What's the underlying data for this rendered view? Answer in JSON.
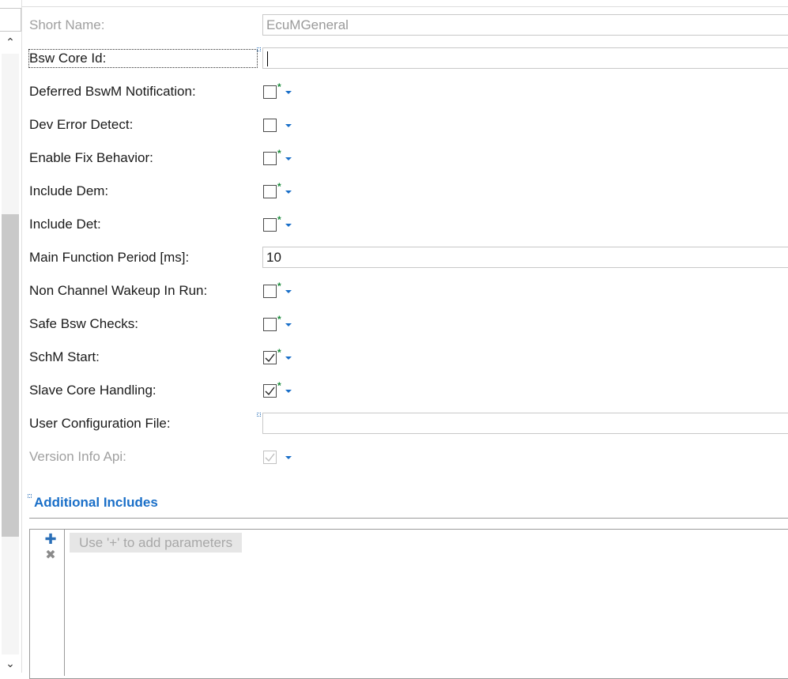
{
  "form": {
    "short_name": {
      "label": "Short Name:",
      "value": "EcuMGeneral"
    },
    "bsw_core_id": {
      "label": "Bsw Core Id:",
      "value": ""
    },
    "deferred_bswm_notification": {
      "label": "Deferred BswM Notification:",
      "checked": false
    },
    "dev_error_detect": {
      "label": "Dev Error Detect:",
      "checked": false
    },
    "enable_fix_behavior": {
      "label": "Enable Fix Behavior:",
      "checked": false
    },
    "include_dem": {
      "label": "Include Dem:",
      "checked": false
    },
    "include_det": {
      "label": "Include Det:",
      "checked": false
    },
    "main_function_period": {
      "label": "Main Function Period [ms]:",
      "value": "10"
    },
    "non_channel_wakeup_in_run": {
      "label": "Non Channel Wakeup In Run:",
      "checked": false
    },
    "safe_bsw_checks": {
      "label": "Safe Bsw Checks:",
      "checked": false
    },
    "schm_start": {
      "label": "SchM Start:",
      "checked": true
    },
    "slave_core_handling": {
      "label": "Slave Core Handling:",
      "checked": true
    },
    "user_configuration_file": {
      "label": "User Configuration File:",
      "value": ""
    },
    "version_info_api": {
      "label": "Version Info Api:",
      "checked": true,
      "disabled": true
    }
  },
  "additional_includes": {
    "title": "Additional Includes",
    "placeholder": "Use '+' to add parameters",
    "add_icon": "plus-icon",
    "remove_icon": "close-icon"
  },
  "colors": {
    "accent": "#1a6fc8",
    "modified_marker": "#1a8a3a",
    "disabled_text": "#a0a0a0"
  }
}
